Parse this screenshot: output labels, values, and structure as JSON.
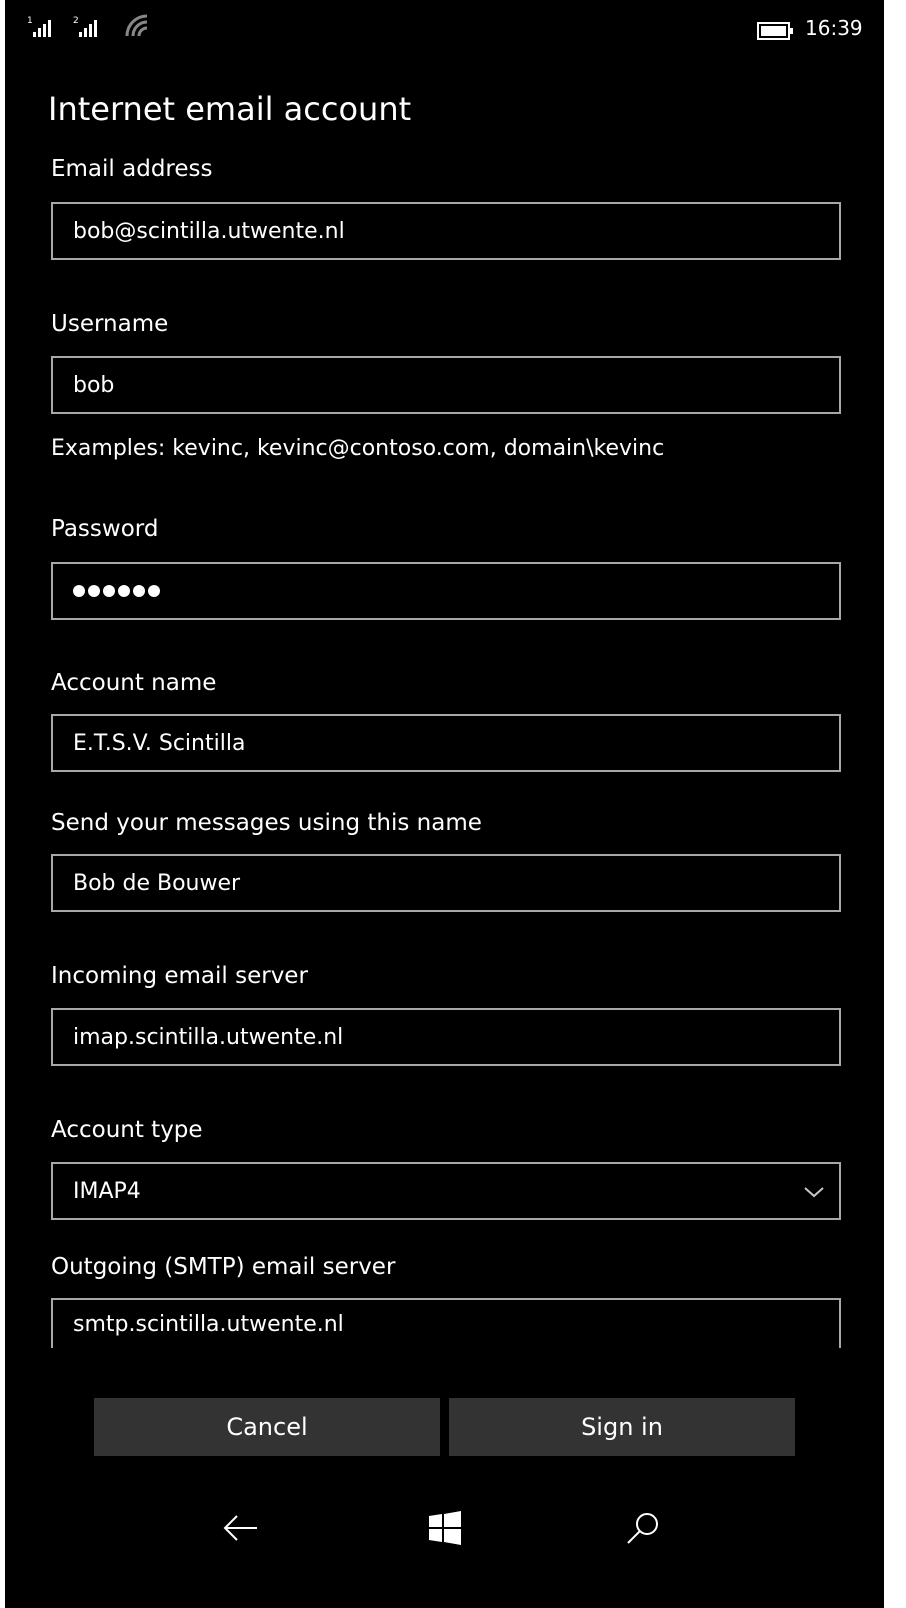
{
  "status": {
    "sim1": "1",
    "sim2": "2",
    "time": "16:39"
  },
  "title": "Internet email account",
  "fields": {
    "email": {
      "label": "Email address",
      "value": "bob@scintilla.utwente.nl"
    },
    "username": {
      "label": "Username",
      "value": "bob",
      "hint": "Examples: kevinc, kevinc@contoso.com, domain\\kevinc"
    },
    "password": {
      "label": "Password",
      "dots": 6
    },
    "account_name": {
      "label": "Account name",
      "value": "E.T.S.V. Scintilla"
    },
    "send_name": {
      "label": "Send your messages using this name",
      "value": "Bob de Bouwer"
    },
    "incoming": {
      "label": "Incoming email server",
      "value": "imap.scintilla.utwente.nl"
    },
    "account_type": {
      "label": "Account type",
      "value": "IMAP4"
    },
    "outgoing": {
      "label": "Outgoing (SMTP) email server",
      "value": "smtp.scintilla.utwente.nl"
    }
  },
  "buttons": {
    "cancel": "Cancel",
    "sign_in": "Sign in"
  },
  "icons": {
    "signal": "signal-icon",
    "wifi": "wifi-icon",
    "battery": "battery-icon",
    "chevron": "chevron-down-icon",
    "back": "back-arrow-icon",
    "windows": "windows-logo-icon",
    "search": "search-icon"
  },
  "colors": {
    "background": "#000000",
    "text": "#ffffff",
    "border": "#a8a8a8",
    "button": "#333333"
  }
}
